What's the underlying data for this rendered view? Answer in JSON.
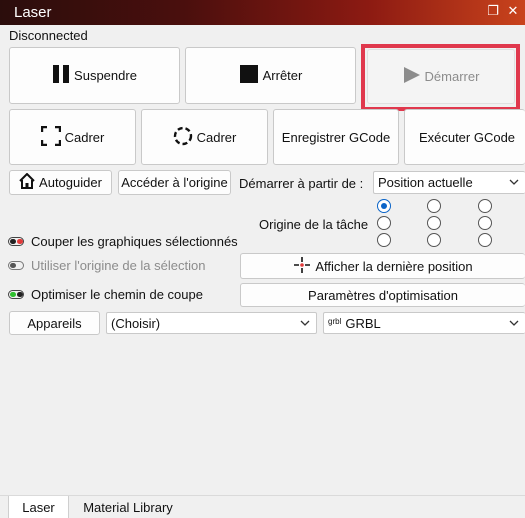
{
  "window": {
    "title": "Laser"
  },
  "status": "Disconnected",
  "buttons": {
    "pause": "Suspendre",
    "stop": "Arrêter",
    "start": "Démarrer",
    "frame1": "Cadrer",
    "frame2": "Cadrer",
    "save_gcode": "Enregistrer GCode",
    "run_gcode": "Exécuter GCode",
    "home": "Autoguider",
    "goto_origin": "Accéder à l'origine",
    "show_last_position": "Afficher la dernière position",
    "optimization_settings": "Paramètres d'optimisation",
    "devices": "Appareils"
  },
  "start_from": {
    "label": "Démarrer à partir de :",
    "value": "Position actuelle"
  },
  "job_origin": {
    "label": "Origine de la tâche",
    "selected": "top-left"
  },
  "options": {
    "cut_selected": "Couper les graphiques sélectionnés",
    "use_selection_origin": "Utiliser l'origine de la sélection",
    "optimize_cut_path": "Optimiser le chemin de coupe"
  },
  "device_select": {
    "value": "(Choisir)"
  },
  "controller_select": {
    "prefix": "grbl",
    "value": "GRBL"
  },
  "tabs": [
    "Laser",
    "Material Library"
  ],
  "colors": {
    "highlight": "#e0384d",
    "toggle_off_red": "#e23b3b",
    "toggle_on_green": "#2fbf2f",
    "radio_selected": "#0a64c8"
  }
}
